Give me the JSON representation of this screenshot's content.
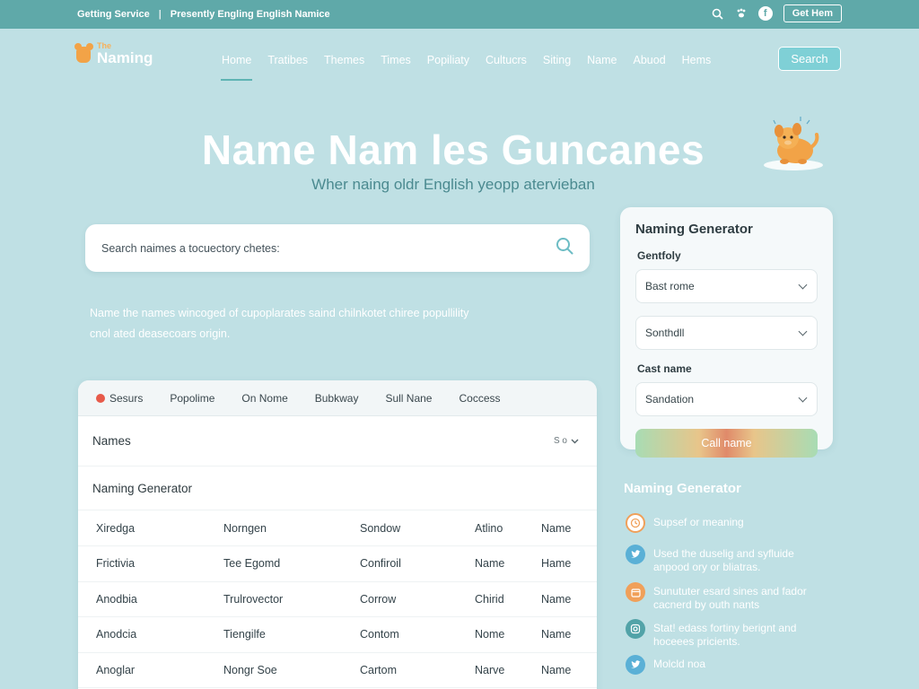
{
  "topbar": {
    "left_text": "Getting Service",
    "tagline": "Presently Engling English Namice",
    "button_label": "Get Hem",
    "facebook_glyph": "f"
  },
  "logo": {
    "small": "The",
    "big": "Naming"
  },
  "nav": {
    "items": [
      "Home",
      "Tratibes",
      "Themes",
      "Times",
      "Popiliaty",
      "Cultucrs",
      "Siting",
      "Name",
      "Abuod",
      "Hems"
    ],
    "active_index": 0,
    "search_button": "Search"
  },
  "hero": {
    "title": "Name Nam les Guncanes",
    "subtitle": "Wher naing oldr English yeopp atervieban"
  },
  "search": {
    "placeholder": "Search naimes a tocuectory chetes:"
  },
  "description": "Name the names wincoged of cupoplarates saind chilnkotet chiree popullility cnol ated deasecoars origin.",
  "card": {
    "tabs": [
      {
        "label": "Sesurs",
        "icon": "red-dot"
      },
      {
        "label": "Popolime"
      },
      {
        "label": "On Nome"
      },
      {
        "label": "Bubkway"
      },
      {
        "label": "Sull Nane"
      },
      {
        "label": "Coccess"
      }
    ],
    "header_title": "Names",
    "sort_label": "S o",
    "section_title": "Naming Generator",
    "rows": [
      [
        "Xiredga",
        "Norngen",
        "Sondow",
        "Atlino",
        "Name"
      ],
      [
        "Frictivia",
        "Tee Egomd",
        "Confiroil",
        "Name",
        "Hame"
      ],
      [
        "Anodbia",
        "Trulrovector",
        "Corrow",
        "Chirid",
        "Name"
      ],
      [
        "Anodcia",
        "Tiengilfe",
        "Contom",
        "Nome",
        "Name"
      ],
      [
        "Anoglar",
        "Nongr Soe",
        "Cartom",
        "Narve",
        "Name"
      ]
    ]
  },
  "panel": {
    "title": "Naming Generator",
    "label1": "Gentfoly",
    "select1": "Bast rome",
    "select2": "Sonthdll",
    "label2": "Cast name",
    "select3": "Sandation",
    "button": "Call name"
  },
  "features": {
    "title": "Naming Generator",
    "items": [
      {
        "icon": "clock-icon",
        "color": "#f0a05a",
        "text": "Supsef or meaning"
      },
      {
        "icon": "twitter-icon",
        "color": "#5ab0d6",
        "text": "Used the duselig and syfluide anpood ory or bliatras."
      },
      {
        "icon": "calendar-icon",
        "color": "#f0a05a",
        "text": "Sunututer esard sines and fador cacnerd by outh nants"
      },
      {
        "icon": "instagram-icon",
        "color": "#52a3a8",
        "text": "Stat! edass fortiny berignt and hoceees pricients."
      },
      {
        "icon": "twitter-icon",
        "color": "#5ab0d6",
        "text": "Molcld noa"
      }
    ]
  },
  "colors": {
    "background": "#bfe0e4",
    "topbar": "#5fa9a9",
    "accent": "#7fd0d6",
    "logo_orange": "#f2a347"
  }
}
